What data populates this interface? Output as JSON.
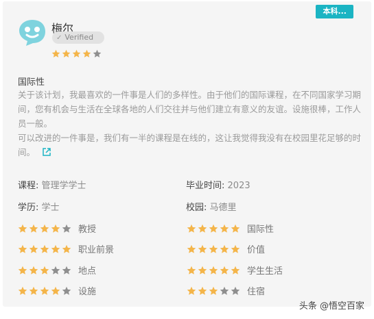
{
  "tag": "本科...",
  "reviewer": {
    "name": "梅尔",
    "verified_label": "Verified",
    "rating": 4,
    "max_rating": 5
  },
  "review": {
    "title": "国际性",
    "paragraph1": "关于该计划，我最喜欢的一件事是人们的多样性。由于他们的国际课程，在不同国家学习期间，您有机会与生活在全球各地的人们交往并与他们建立有意义的友谊。设施很棒，工作人员一般。",
    "paragraph2": "可以改进的一件事是，我们有一半的课程是在线的，这让我觉得我没有在校园里花足够的时间。"
  },
  "details": {
    "course_label": "课程:",
    "course_value": "管理学学士",
    "grad_label": "毕业时间:",
    "grad_value": "2023",
    "degree_label": "学历:",
    "degree_value": "学士",
    "campus_label": "校园:",
    "campus_value": "马德里"
  },
  "ratings": [
    {
      "label": "教授",
      "value": 4
    },
    {
      "label": "国际性",
      "value": 5
    },
    {
      "label": "职业前景",
      "value": 5
    },
    {
      "label": "价值",
      "value": 5
    },
    {
      "label": "地点",
      "value": 3
    },
    {
      "label": "学生生活",
      "value": 5
    },
    {
      "label": "设施",
      "value": 4
    },
    {
      "label": "住宿",
      "value": 3
    }
  ],
  "watermark": "头条 @悟空百家",
  "colors": {
    "tag_bg": "#1bb4c3",
    "star_on": "#f4b54a",
    "star_off": "#8f8f8f",
    "link": "#1bb4c3"
  },
  "icons": {
    "avatar": "speech-bubble-face-icon",
    "verified": "check-icon",
    "link": "external-link-icon"
  }
}
